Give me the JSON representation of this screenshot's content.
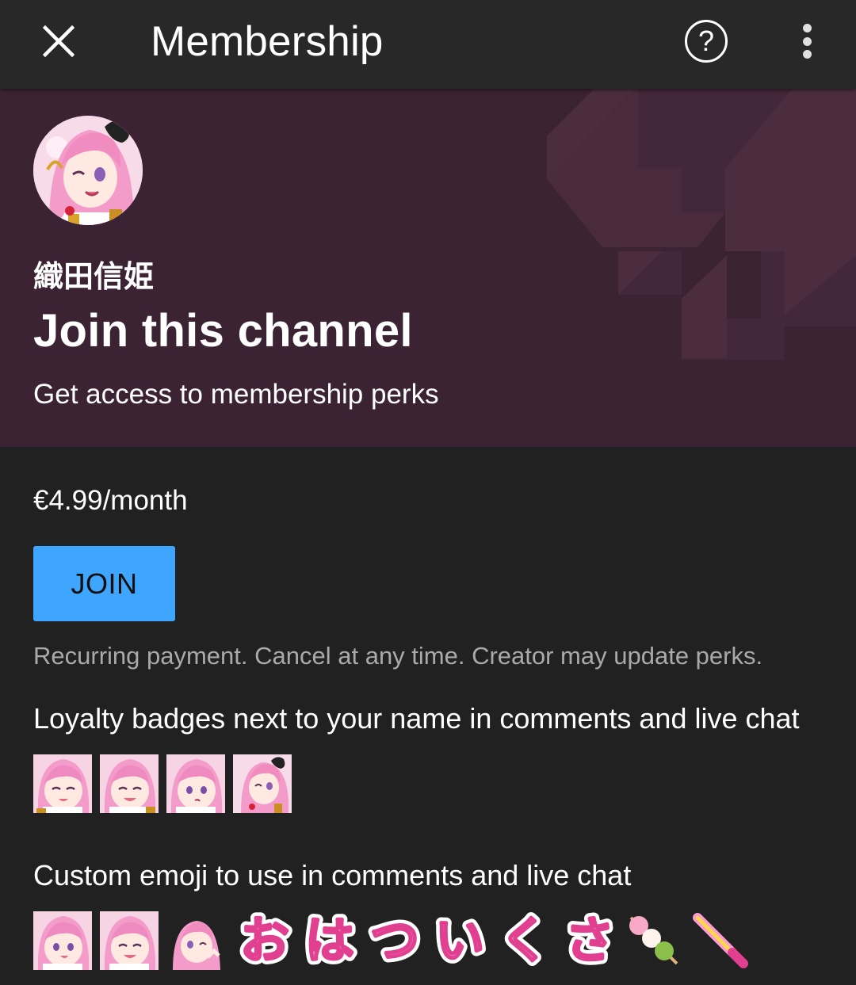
{
  "header": {
    "title": "Membership",
    "close_icon": "close-icon",
    "help_glyph": "?",
    "help_icon": "help-circle-icon",
    "more_icon": "more-vertical-icon"
  },
  "hero": {
    "channel_name": "織田信姫",
    "title": "Join this channel",
    "subtitle": "Get access to membership perks",
    "background_color": "#3c2333"
  },
  "membership": {
    "price": "€4.99/month",
    "join_label": "JOIN",
    "join_color": "#3ea6ff",
    "disclaimer": "Recurring payment. Cancel at any time. Creator may update perks."
  },
  "perks": [
    {
      "heading": "Loyalty badges next to your name in comments and live chat",
      "items": [
        "badge-anime-girl-happy",
        "badge-anime-girl-smile",
        "badge-anime-girl-talk",
        "badge-anime-girl-wink"
      ]
    },
    {
      "heading": "Custom emoji to use in comments and live chat",
      "items": [
        "emoji-anime-girl-talk",
        "emoji-anime-girl-smile",
        "emoji-anime-girl-wink"
      ],
      "text_emoji": [
        "お",
        "は",
        "つ",
        "い",
        "く",
        "さ"
      ],
      "icon_emoji": [
        "dango-icon",
        "glowstick-icon"
      ]
    }
  ]
}
